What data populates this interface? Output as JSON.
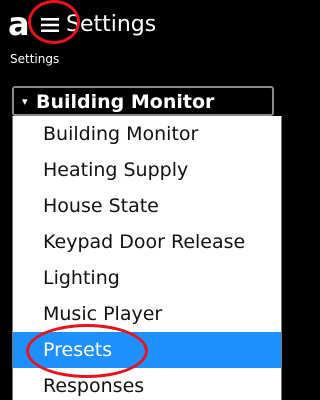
{
  "header": {
    "logo_text": "a",
    "title": "Settings",
    "breadcrumb": "Settings"
  },
  "icons": {
    "menu": "hamburger-menu-icon",
    "dropdown_arrow": "triangle-down-icon"
  },
  "select": {
    "selected_value": "Building Monitor",
    "arrow": "▾"
  },
  "dropdown": {
    "options": [
      "Building Monitor",
      "Heating Supply",
      "House State",
      "Keypad Door Release",
      "Lighting",
      "Music Player",
      "Presets",
      "Responses"
    ],
    "highlighted_index": 6
  },
  "colors": {
    "highlight": "#1e90ff",
    "annotation_ring": "#e8141d",
    "background": "#000000"
  }
}
